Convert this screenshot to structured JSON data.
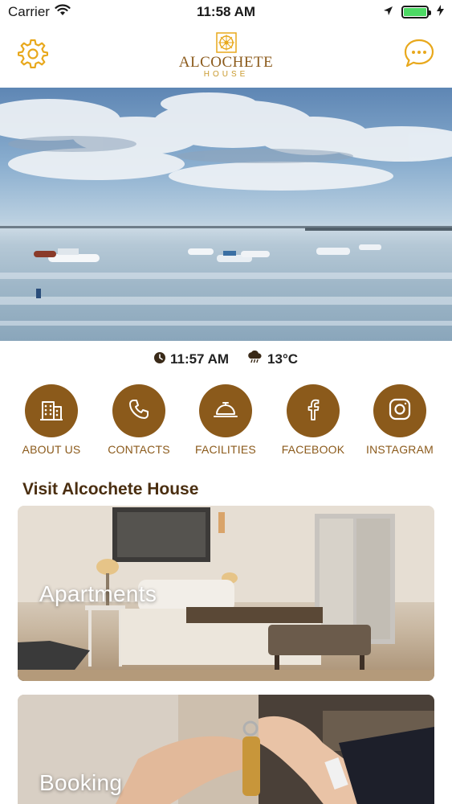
{
  "status_bar": {
    "carrier": "Carrier",
    "time": "11:58 AM",
    "wifi_icon": "wifi-icon",
    "location_icon": "location-arrow-icon",
    "battery_icon": "battery-icon",
    "charging_icon": "bolt-icon"
  },
  "header": {
    "logo_name": "ALCOCHETE",
    "logo_sub": "HOUSE",
    "left_icon": "gear-icon",
    "right_icon": "chat-bubble-icon"
  },
  "info": {
    "time": "11:57 AM",
    "temperature": "13°C",
    "clock_icon": "clock-icon",
    "weather_icon": "cloud-rain-icon"
  },
  "actions": [
    {
      "label": "ABOUT US",
      "icon": "building-icon"
    },
    {
      "label": "CONTACTS",
      "icon": "phone-icon"
    },
    {
      "label": "FACILITIES",
      "icon": "service-bell-icon"
    },
    {
      "label": "FACEBOOK",
      "icon": "facebook-icon"
    },
    {
      "label": "INSTAGRAM",
      "icon": "instagram-icon"
    }
  ],
  "section": {
    "title": "Visit Alcochete House"
  },
  "cards": [
    {
      "label": "Apartments"
    },
    {
      "label": "Booking"
    }
  ],
  "colors": {
    "accent": "#8b5a1b",
    "gold": "#e8a81c",
    "section_title": "#4a2e10"
  }
}
